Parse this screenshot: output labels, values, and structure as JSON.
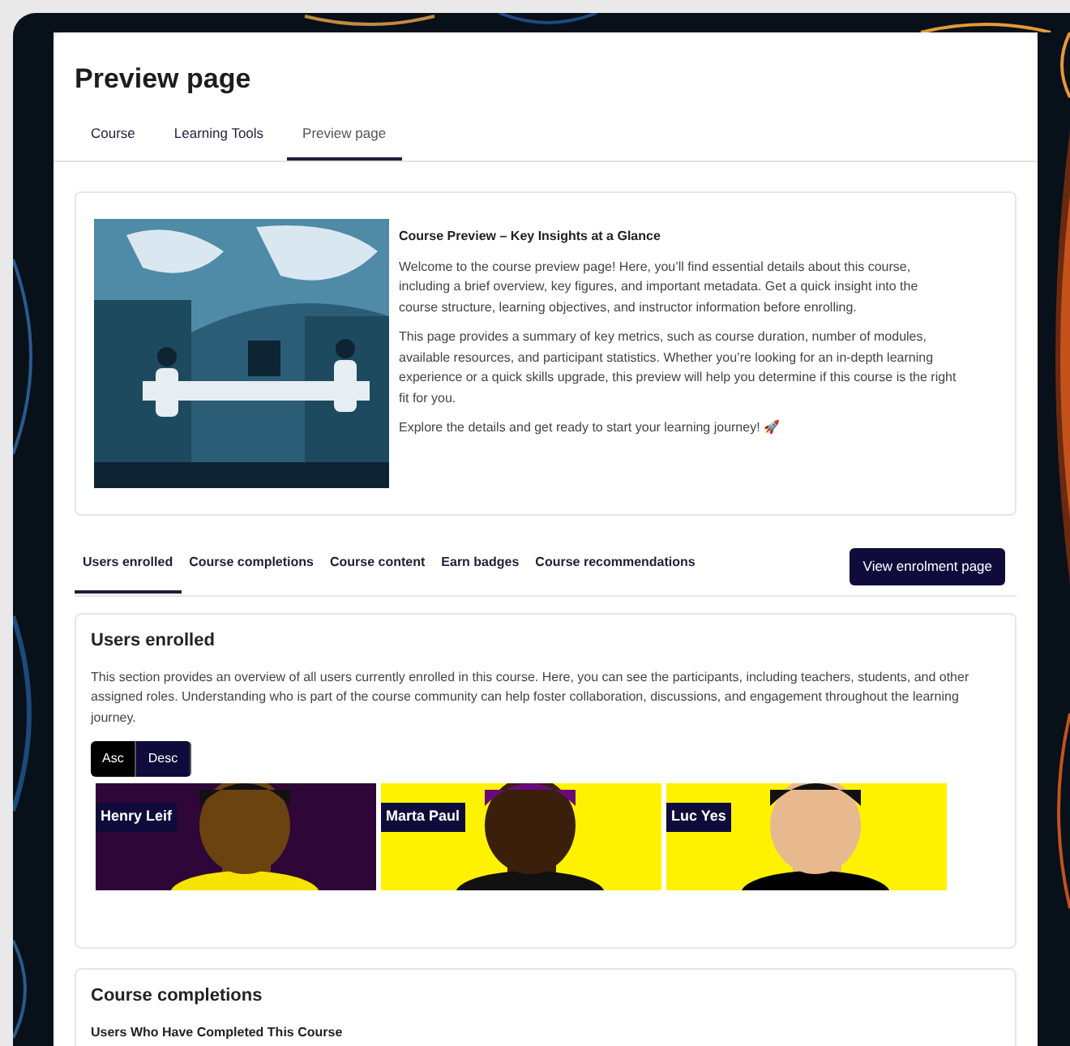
{
  "page": {
    "title": "Preview page"
  },
  "tabs": [
    {
      "label": "Course",
      "selected": false
    },
    {
      "label": "Learning Tools",
      "selected": false
    },
    {
      "label": "Preview page",
      "selected": true
    }
  ],
  "hero": {
    "kind": "picture",
    "heading": "Course Preview – Key Insights at a Glance",
    "paragraphs": [
      "Welcome to the course preview page! Here, you’ll find essential details about this course, including a brief overview, key figures, and important metadata. Get a quick insight into the course structure, learning objectives, and instructor information before enrolling.",
      "This page provides a summary of key metrics, such as course duration, number of modules, available resources, and participant statistics. Whether you’re looking for an in-depth learning experience or a quick skills upgrade, this preview will help you determine if this course is the right fit for you.",
      "Explore the details and get ready to start your learning journey! 🚀"
    ]
  },
  "section_tabs": [
    {
      "label": "Users enrolled",
      "selected": true
    },
    {
      "label": "Course completions",
      "selected": false
    },
    {
      "label": "Course content",
      "selected": false
    },
    {
      "label": "Earn badges",
      "selected": false
    },
    {
      "label": "Course recommendations",
      "selected": false
    }
  ],
  "enrolment_button": "View enrolment page",
  "users_enrolled": {
    "title": "Users enrolled",
    "description": "This section provides an overview of all users currently enrolled in this course. Here, you can see the participants, including teachers, students, and other assigned roles. Understanding who is part of the course community can help foster collaboration, discussions, and engagement throughout the learning journey.",
    "sort": [
      {
        "label": "Asc",
        "selected": true
      },
      {
        "label": "Desc",
        "selected": false
      }
    ],
    "users": [
      {
        "name": "Henry Leif"
      },
      {
        "name": "Marta Paul"
      },
      {
        "name": "Luc Yes"
      }
    ]
  },
  "course_completions": {
    "title": "Course completions",
    "subtitle": "Users Who Have Completed This Course"
  }
}
